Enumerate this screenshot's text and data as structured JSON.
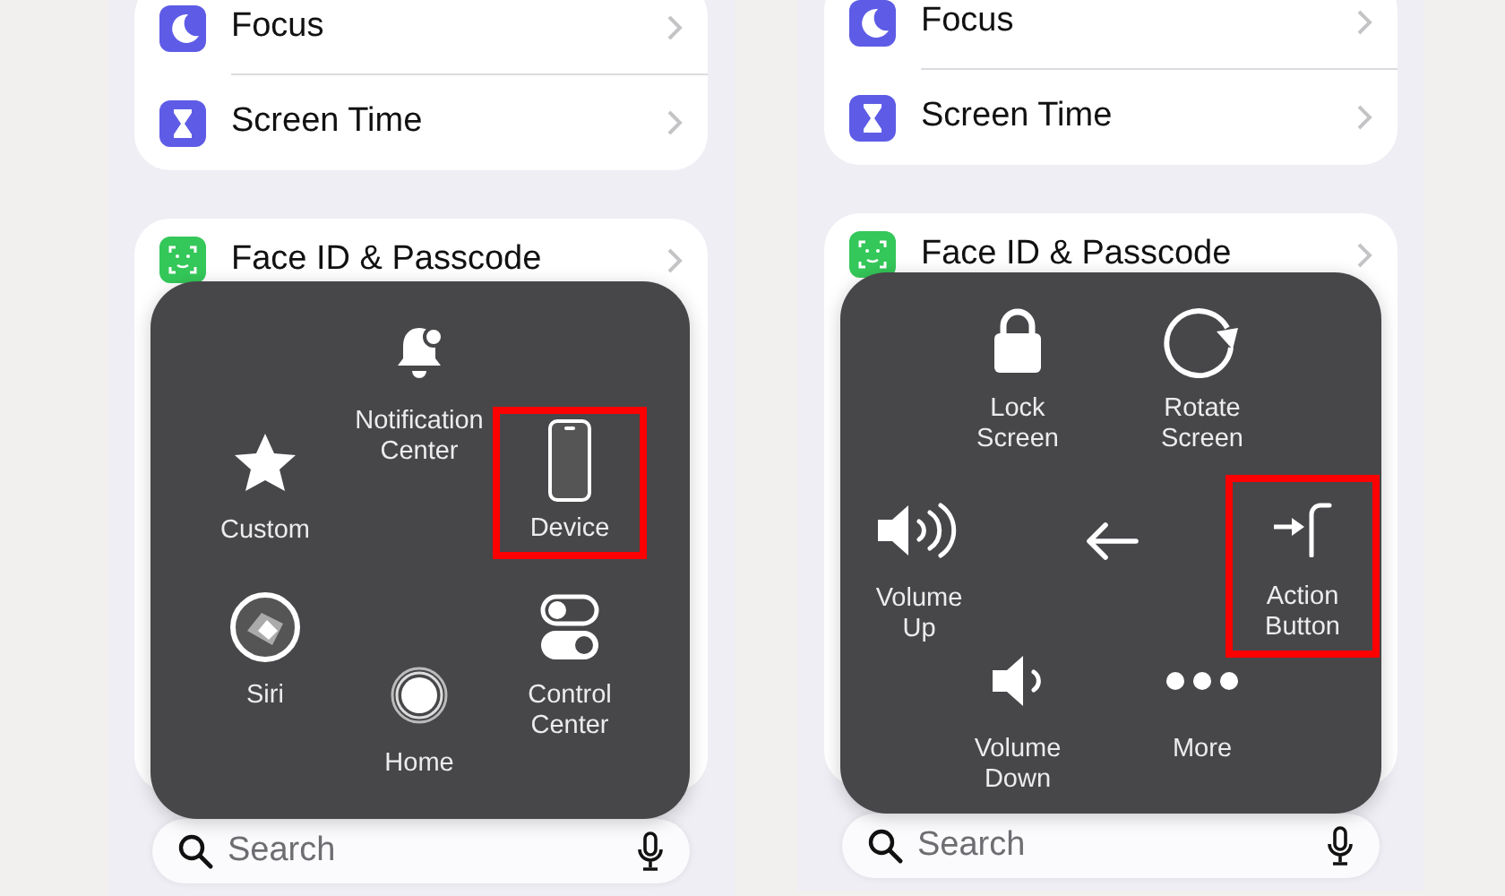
{
  "panels": [
    {
      "settings_groups": [
        {
          "rows": [
            {
              "kind": "moon",
              "label": "Focus",
              "color": "#5e5ce6"
            },
            {
              "kind": "hourglass",
              "label": "Screen Time",
              "color": "#5e5ce6"
            }
          ]
        },
        {
          "rows": [
            {
              "kind": "faceid",
              "label": "Face ID & Passcode",
              "color": "#34c759"
            }
          ]
        }
      ],
      "menu": {
        "items": [
          {
            "kind": "notification",
            "label": "Notification Center",
            "highlighted": false
          },
          {
            "kind": "star",
            "label": "Custom",
            "highlighted": false
          },
          {
            "kind": "device",
            "label": "Device",
            "highlighted": true
          },
          {
            "kind": "siri",
            "label": "Siri",
            "highlighted": false
          },
          {
            "kind": "home",
            "label": "Home",
            "highlighted": false
          },
          {
            "kind": "toggles",
            "label": "Control Center",
            "highlighted": false
          }
        ]
      },
      "search": {
        "placeholder": "Search"
      }
    },
    {
      "settings_groups": [
        {
          "rows": [
            {
              "kind": "moon",
              "label": "Focus",
              "color": "#5e5ce6"
            },
            {
              "kind": "hourglass",
              "label": "Screen Time",
              "color": "#5e5ce6"
            }
          ]
        },
        {
          "rows": [
            {
              "kind": "faceid",
              "label": "Face ID & Passcode",
              "color": "#34c759"
            }
          ]
        }
      ],
      "menu": {
        "items": [
          {
            "kind": "lock",
            "label": "Lock Screen",
            "highlighted": false
          },
          {
            "kind": "rotate",
            "label": "Rotate Screen",
            "highlighted": false
          },
          {
            "kind": "volume-up",
            "label": "Volume Up",
            "highlighted": false
          },
          {
            "kind": "back",
            "highlighted": false
          },
          {
            "kind": "action",
            "label": "Action Button",
            "highlighted": true
          },
          {
            "kind": "volume-down",
            "label": "Volume Down",
            "highlighted": false
          },
          {
            "kind": "more",
            "label": "More",
            "highlighted": false
          }
        ]
      },
      "search": {
        "placeholder": "Search"
      }
    }
  ]
}
